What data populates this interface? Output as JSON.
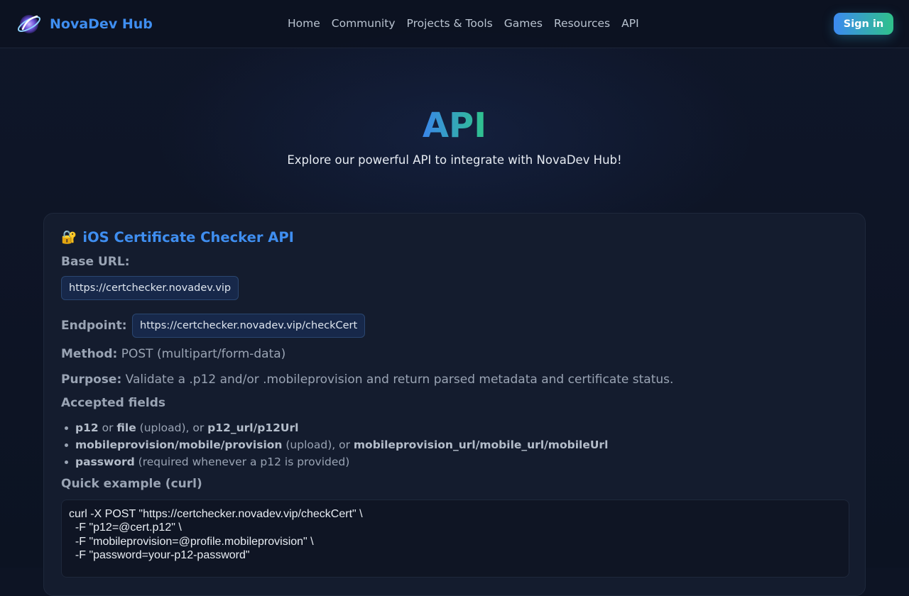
{
  "header": {
    "brand": "NovaDev Hub",
    "nav": [
      "Home",
      "Community",
      "Projects & Tools",
      "Games",
      "Resources",
      "API"
    ],
    "signin_label": "Sign in"
  },
  "hero": {
    "title": "API",
    "subtitle": "Explore our powerful API to integrate with NovaDev Hub!"
  },
  "card": {
    "emoji": "🔐",
    "title": "iOS Certificate Checker API",
    "base_url_label": "Base URL:",
    "base_url": "https://certchecker.novadev.vip",
    "endpoint_label": "Endpoint:",
    "endpoint": "https://certchecker.novadev.vip/checkCert",
    "method_label": "Method:",
    "method": "POST (multipart/form-data)",
    "purpose_label": "Purpose:",
    "purpose": "Validate a .p12 and/or .mobileprovision and return parsed metadata and certificate status.",
    "fields_title": "Accepted fields",
    "fields": [
      {
        "a": "p12",
        "t1": " or ",
        "b": "file",
        "t2": " (upload), or ",
        "c": "p12_url/p12Url",
        "t3": ""
      },
      {
        "a": "mobileprovision/mobile/provision",
        "t1": " (upload), or ",
        "b": "mobileprovision_url/mobile_url/mobileUrl",
        "t2": "",
        "c": "",
        "t3": ""
      },
      {
        "a": "password",
        "t1": " (required whenever a p12 is provided)",
        "b": "",
        "t2": "",
        "c": "",
        "t3": ""
      }
    ],
    "example_title": "Quick example (curl)",
    "code": "curl -X POST \"https://certchecker.novadev.vip/checkCert\" \\\n  -F \"p12=@cert.p12\" \\\n  -F \"mobileprovision=@profile.mobileprovision\" \\\n  -F \"password=your-p12-password\""
  }
}
